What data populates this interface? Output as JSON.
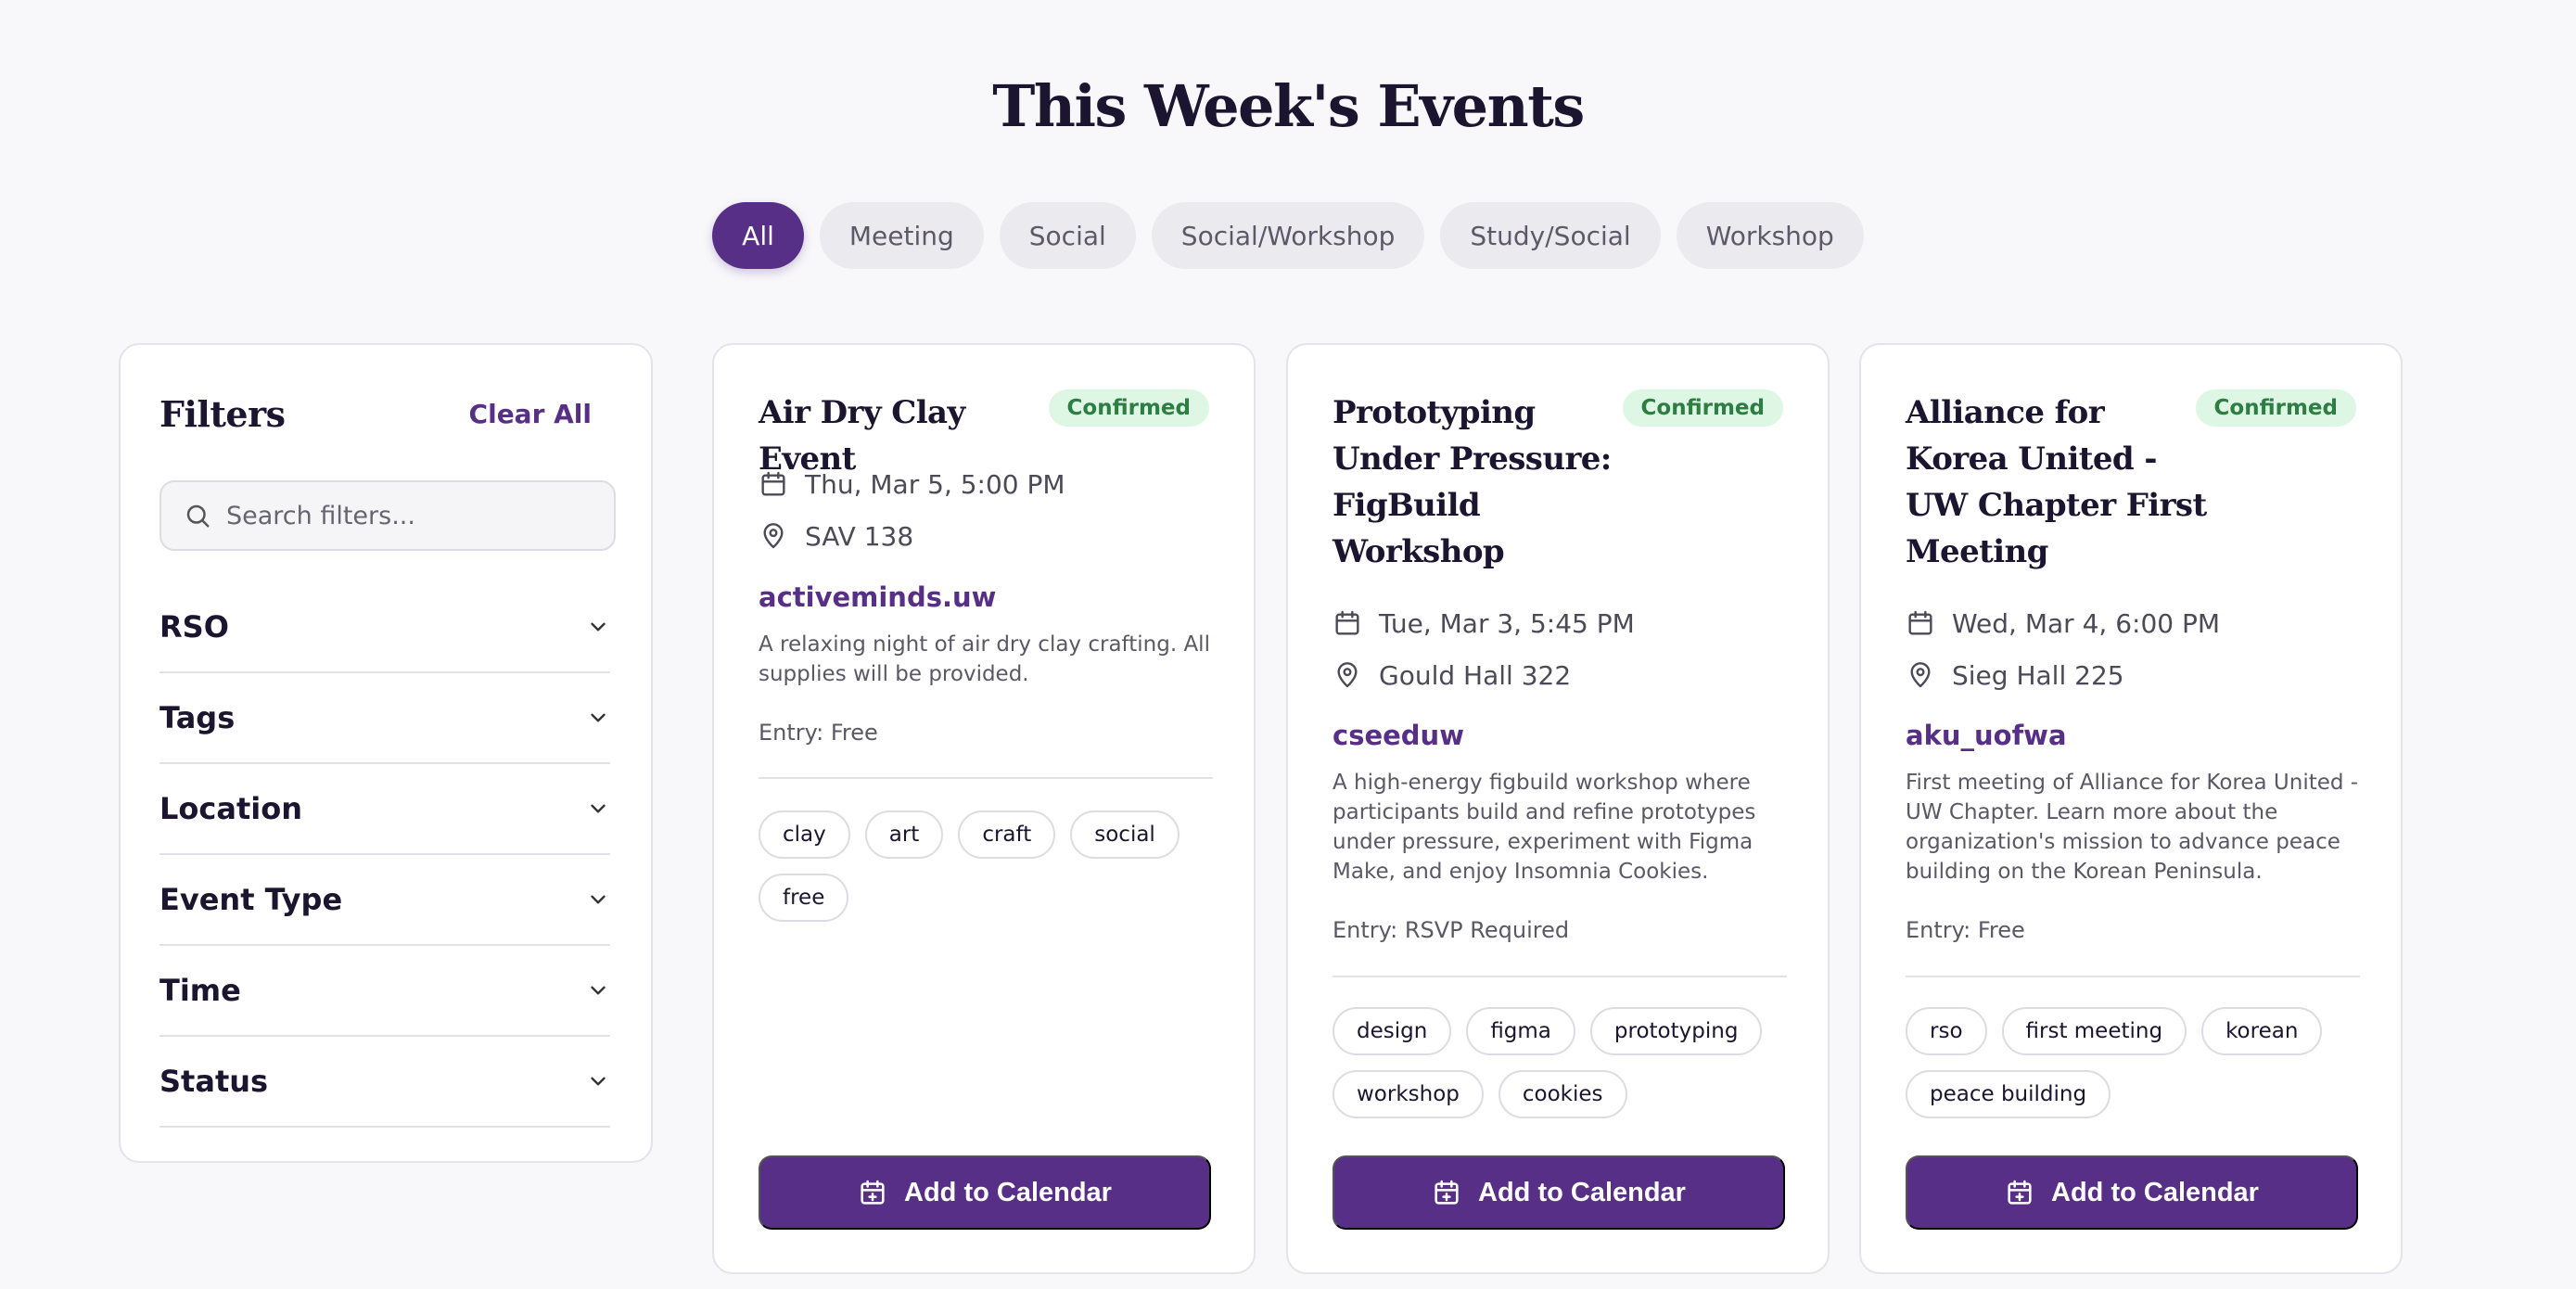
{
  "page": {
    "title": "This Week's Events"
  },
  "tabs": [
    {
      "label": "All",
      "active": true
    },
    {
      "label": "Meeting"
    },
    {
      "label": "Social"
    },
    {
      "label": "Social/Workshop"
    },
    {
      "label": "Study/Social"
    },
    {
      "label": "Workshop"
    }
  ],
  "filters": {
    "title": "Filters",
    "clear_label": "Clear All",
    "search_placeholder": "Search filters...",
    "sections": [
      "RSO",
      "Tags",
      "Location",
      "Event Type",
      "Time",
      "Status"
    ]
  },
  "events": [
    {
      "title": "Air Dry Clay Event",
      "status": "Confirmed",
      "datetime": "Thu, Mar 5, 5:00 PM",
      "location": "SAV 138",
      "org": "activeminds.uw",
      "description": "A relaxing night of air dry clay crafting. All supplies will be provided.",
      "entry": "Entry: Free",
      "tags": [
        "clay",
        "art",
        "craft",
        "social",
        "free"
      ],
      "button_label": "Add to Calendar"
    },
    {
      "title": "Prototyping Under Pressure: FigBuild Workshop",
      "status": "Confirmed",
      "datetime": "Tue, Mar 3, 5:45 PM",
      "location": "Gould Hall 322",
      "org": "cseeduw",
      "description": "A high-energy figbuild workshop where participants build and refine prototypes under pressure, experiment with Figma Make, and enjoy Insomnia Cookies.",
      "entry": "Entry: RSVP Required",
      "tags": [
        "design",
        "figma",
        "prototyping",
        "workshop",
        "cookies"
      ],
      "button_label": "Add to Calendar"
    },
    {
      "title": "Alliance for Korea United - UW Chapter First Meeting",
      "status": "Confirmed",
      "datetime": "Wed, Mar 4, 6:00 PM",
      "location": "Sieg Hall 225",
      "org": "aku_uofwa",
      "description": "First meeting of Alliance for Korea United - UW Chapter. Learn more about the organization's mission to advance peace building on the Korean Peninsula.",
      "entry": "Entry: Free",
      "tags": [
        "rso",
        "first meeting",
        "korean",
        "peace building"
      ],
      "button_label": "Add to Calendar"
    }
  ],
  "colors": {
    "accent": "#572f87",
    "badge_bg": "#ddf7e4",
    "badge_text": "#2e7d43"
  },
  "icons": {
    "calendar": "calendar-icon",
    "location": "map-pin-icon",
    "search": "search-icon",
    "chevron": "chevron-down-icon",
    "add_calendar": "calendar-plus-icon"
  }
}
